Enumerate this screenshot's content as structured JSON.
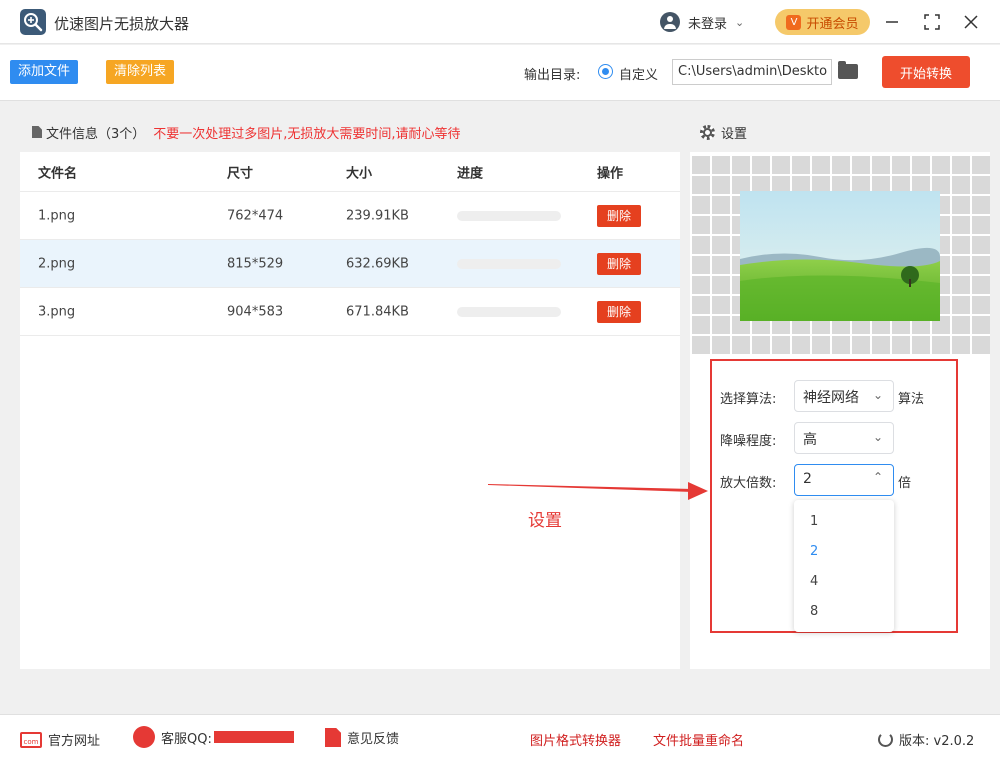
{
  "app": {
    "title": "优速图片无损放大器"
  },
  "header": {
    "user_label": "未登录",
    "vip_label": "开通会员",
    "vip_icon_text": "V"
  },
  "toolbar": {
    "add_label": "添加文件",
    "clear_label": "清除列表",
    "output_label": "输出目录:",
    "radio_label": "自定义",
    "path_value": "C:\\Users\\admin\\Deskto",
    "start_label": "开始转换"
  },
  "file_panel": {
    "title": "文件信息（3个）",
    "warning": "不要一次处理过多图片,无损放大需要时间,请耐心等待",
    "columns": [
      "文件名",
      "尺寸",
      "大小",
      "进度",
      "操作"
    ],
    "rows": [
      {
        "name": "1.png",
        "size": "762*474",
        "filesize": "239.91KB",
        "progress": 0,
        "action": "删除"
      },
      {
        "name": "2.png",
        "size": "815*529",
        "filesize": "632.69KB",
        "progress": 0,
        "action": "删除"
      },
      {
        "name": "3.png",
        "size": "904*583",
        "filesize": "671.84KB",
        "progress": 0,
        "action": "删除"
      }
    ]
  },
  "settings": {
    "title": "设置",
    "algorithm_label": "选择算法:",
    "algorithm_value": "神经网络",
    "algorithm_unit": "算法",
    "noise_label": "降噪程度:",
    "noise_value": "高",
    "scale_label": "放大倍数:",
    "scale_value": "2",
    "scale_unit": "倍",
    "scale_options": [
      "1",
      "2",
      "4",
      "8"
    ]
  },
  "annotation": {
    "text": "设置"
  },
  "footer": {
    "website": "官方网址",
    "website_icon_text": "com",
    "qq": "客服QQ:",
    "feedback": "意见反馈",
    "converter": "图片格式转换器",
    "rename": "文件批量重命名",
    "version": "版本: v2.0.2"
  },
  "colors": {
    "primary": "#2f8cf0",
    "danger": "#e5401f",
    "warning_text": "#e33333",
    "clear_button": "#f6a623",
    "vip_bg": "#f5c96a"
  }
}
